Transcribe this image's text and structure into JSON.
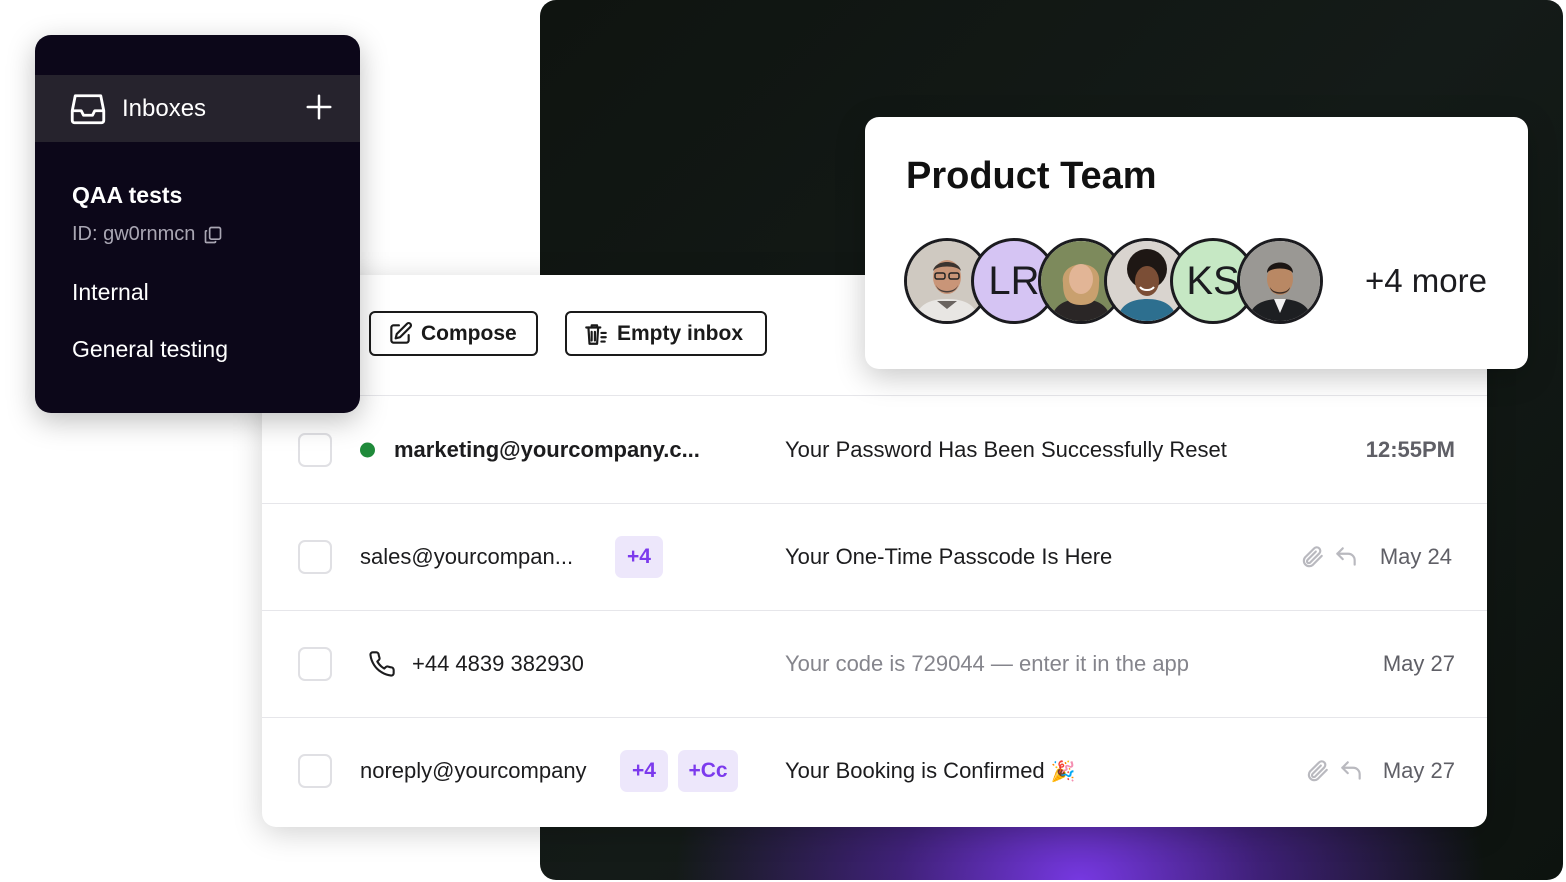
{
  "sidebar": {
    "title": "Inboxes",
    "group_name": "QAA tests",
    "group_id": "ID: gw0rnmcn",
    "items": [
      {
        "label": "Internal"
      },
      {
        "label": "General testing"
      }
    ]
  },
  "toolbar": {
    "compose_label": "Compose",
    "empty_label": "Empty inbox"
  },
  "team_card": {
    "title": "Product Team",
    "avatars": [
      {
        "type": "photo"
      },
      {
        "type": "initials",
        "initials": "LR",
        "color": "#d5c4f3"
      },
      {
        "type": "photo"
      },
      {
        "type": "photo"
      },
      {
        "type": "initials",
        "initials": "KS",
        "color": "#c6e8c4"
      },
      {
        "type": "photo"
      }
    ],
    "more_label": "+4 more"
  },
  "emails": [
    {
      "sender": "marketing@yourcompany.c...",
      "unread": true,
      "subject": "Your Password Has Been Successfully Reset",
      "date": "12:55PM"
    },
    {
      "sender": "sales@yourcompan...",
      "pill_1": "+4",
      "subject": "Your One-Time Passcode Is Here",
      "date": "May 24",
      "attachment": true,
      "replied": true
    },
    {
      "sender": "+44 4839 382930",
      "type": "sms",
      "subject": "Your code is 729044 — enter it in the app",
      "date": "May 27"
    },
    {
      "sender": "noreply@yourcompany",
      "pill_1": "+4",
      "pill_2": "+Cc",
      "subject": "Your Booking is Confirmed",
      "emoji": "🎉",
      "date": "May 27",
      "attachment": true,
      "replied": true
    }
  ],
  "colors": {
    "accent": "#7c3aed",
    "unread_dot": "#1f8a3a",
    "sidebar_bg": "#0c0719"
  }
}
